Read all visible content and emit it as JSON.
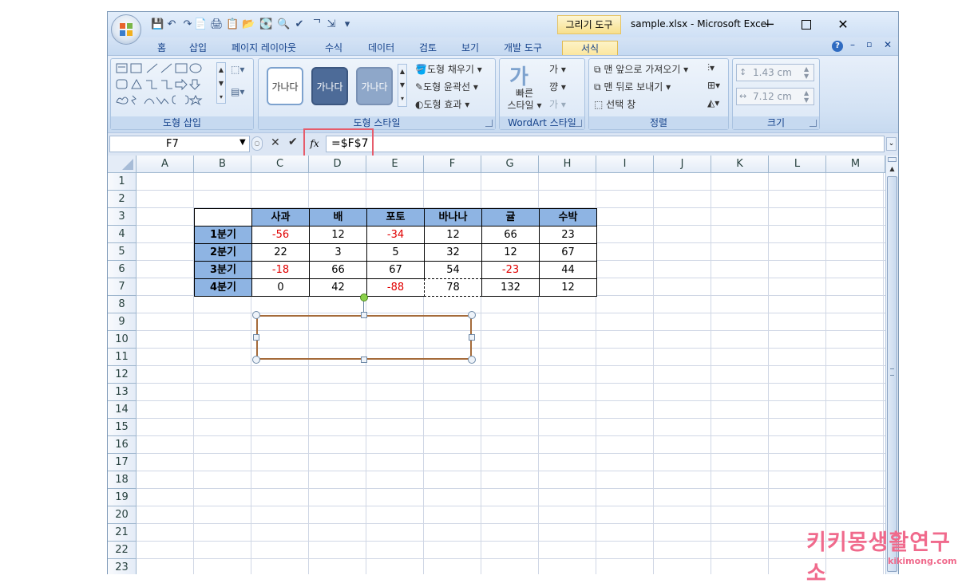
{
  "window": {
    "title": "sample.xlsx - Microsoft Excel",
    "context_tab": "그리기 도구",
    "controls": [
      "─",
      "☐",
      "✕"
    ]
  },
  "quick_access": [
    "💾",
    "↶",
    "↷",
    "📄",
    "🖨",
    "📋",
    "📂",
    "💽",
    "🔍",
    "✔",
    "ᄀ",
    "⇲",
    "▾"
  ],
  "ribbon_tabs": [
    "홈",
    "삽입",
    "페이지 레이아웃",
    "수식",
    "데이터",
    "검토",
    "보기",
    "개발 도구",
    "서식"
  ],
  "ribbon": {
    "groups": {
      "insert_shapes": "도형 삽입",
      "shape_styles": "도형 스타일",
      "wordart": "WordArt 스타일",
      "arrange": "정렬",
      "size": "크기"
    },
    "shape_style_samples": [
      "가나다",
      "가나다",
      "가나다"
    ],
    "shape_fill": "도형 채우기 ▾",
    "shape_outline": "도형 윤곽선 ▾",
    "shape_effect": "도형 효과 ▾",
    "quick_styles": "빠른 스타일 ▾",
    "quick_styles_line1": "빠른",
    "quick_styles_line2": "스타일 ▾",
    "wordart_glyph": "가",
    "bring_front": "맨 앞으로 가져오기 ▾",
    "send_back": "맨 뒤로 보내기 ▾",
    "selection_pane": "선택 창",
    "height": "1.43 cm",
    "width": "7.12 cm"
  },
  "formula_bar": {
    "name_box": "F7",
    "formula": "=$F$7",
    "fx": "fx"
  },
  "columns": [
    "A",
    "B",
    "C",
    "D",
    "E",
    "F",
    "G",
    "H",
    "I",
    "J",
    "K",
    "L",
    "M"
  ],
  "rows": [
    "1",
    "2",
    "3",
    "4",
    "5",
    "6",
    "7",
    "8",
    "9",
    "10",
    "11",
    "12",
    "13",
    "14",
    "15",
    "16",
    "17",
    "18",
    "19",
    "20",
    "21",
    "22",
    "23"
  ],
  "table": {
    "headers": [
      "사과",
      "배",
      "포토",
      "바나나",
      "귤",
      "수박"
    ],
    "row_labels": [
      "1분기",
      "2분기",
      "3분기",
      "4분기"
    ],
    "values": [
      [
        "-56",
        "12",
        "-34",
        "12",
        "66",
        "23"
      ],
      [
        "22",
        "3",
        "5",
        "32",
        "12",
        "67"
      ],
      [
        "-18",
        "66",
        "67",
        "54",
        "-23",
        "44"
      ],
      [
        "0",
        "42",
        "-88",
        "78",
        "132",
        "12"
      ]
    ]
  },
  "watermark": {
    "main": "키키몽생활연구소",
    "sub": "kikimong.com"
  }
}
